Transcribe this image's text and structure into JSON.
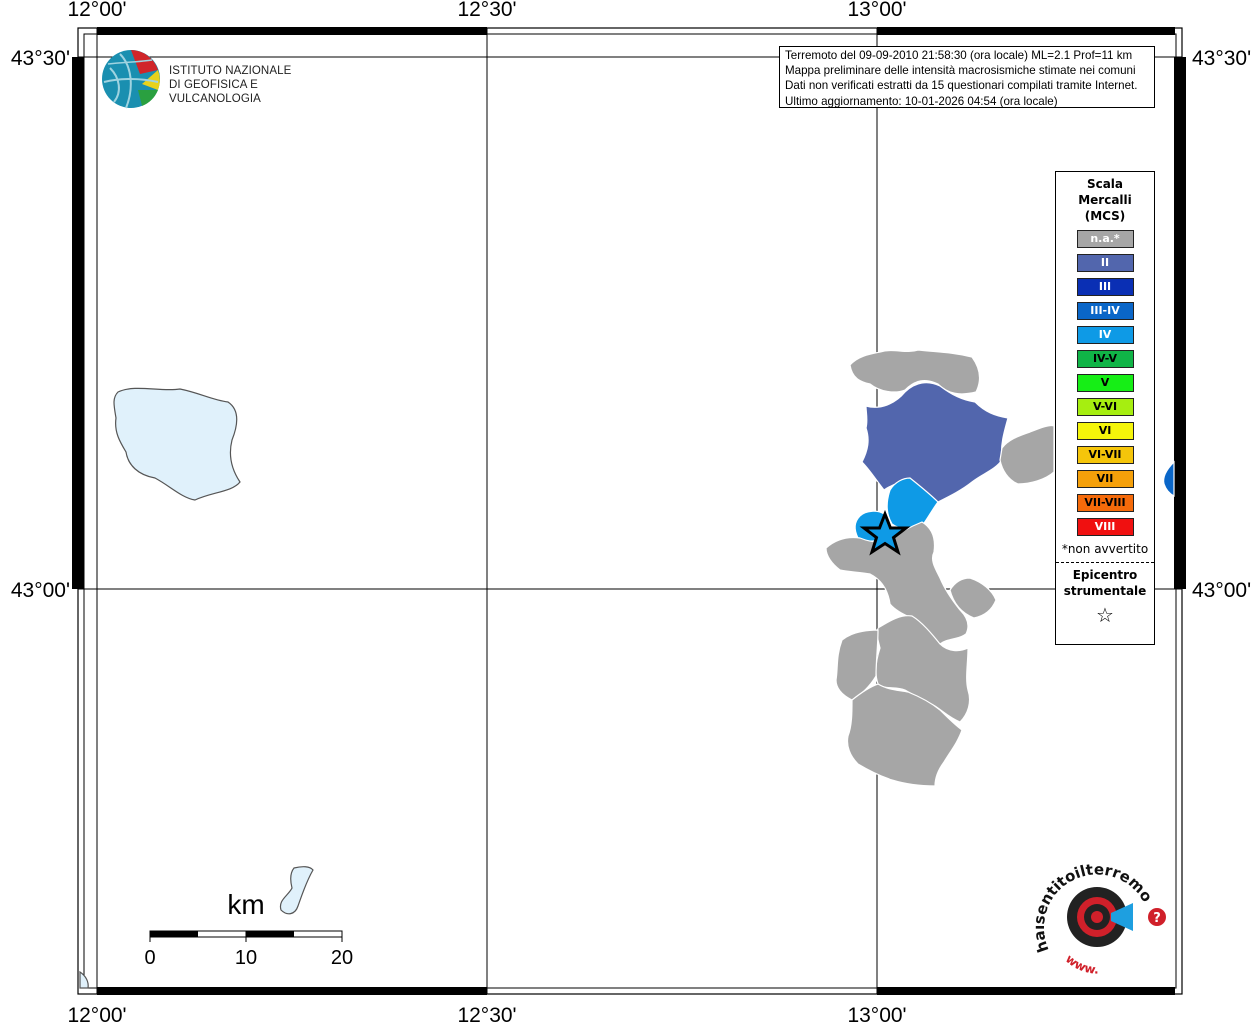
{
  "map": {
    "lon_labels": [
      "12°00'",
      "12°30'",
      "13°00'"
    ],
    "lat_labels": [
      "43°30'",
      "43°00'"
    ]
  },
  "info_box": {
    "lines": [
      "Terremoto del 09-09-2010 21:58:30 (ora locale) ML=2.1 Prof=11 km",
      "Mappa preliminare delle intensità macrosismiche stimate nei comuni",
      "Dati non verificati estratti da 15 questionari compilati tramite Internet.",
      "Ultimo aggiornamento: 10-01-2026 04:54 (ora locale)"
    ]
  },
  "logo": {
    "line1": "ISTITUTO NAZIONALE",
    "line2": "DI GEOFISICA E VULCANOLOGIA"
  },
  "legend": {
    "title_lines": [
      "Scala",
      "Mercalli",
      "(MCS)"
    ],
    "classes": [
      {
        "label": "n.a.*",
        "color": "#a6a6a6",
        "text_color": "#ffffff"
      },
      {
        "label": "II",
        "color": "#5266ad",
        "text_color": "#ffffff"
      },
      {
        "label": "III",
        "color": "#0a2fb4",
        "text_color": "#ffffff"
      },
      {
        "label": "III-IV",
        "color": "#0a66c8",
        "text_color": "#ffffff"
      },
      {
        "label": "IV",
        "color": "#0e9ae6",
        "text_color": "#ffffff"
      },
      {
        "label": "IV-V",
        "color": "#10b447",
        "text_color": "#000000"
      },
      {
        "label": "V",
        "color": "#16ee16",
        "text_color": "#000000"
      },
      {
        "label": "V-VI",
        "color": "#a6ee10",
        "text_color": "#000000"
      },
      {
        "label": "VI",
        "color": "#f5f50a",
        "text_color": "#000000"
      },
      {
        "label": "VI-VII",
        "color": "#f5c50a",
        "text_color": "#000000"
      },
      {
        "label": "VII",
        "color": "#f5a00a",
        "text_color": "#000000"
      },
      {
        "label": "VII-VIII",
        "color": "#f56a0a",
        "text_color": "#000000"
      },
      {
        "label": "VIII",
        "color": "#f01010",
        "text_color": "#ffffff"
      }
    ],
    "note": "*non avvertito",
    "epicenter_lines": [
      "Epicentro",
      "strumentale"
    ],
    "epicenter_symbol": "☆"
  },
  "scale_bar": {
    "unit": "km",
    "ticks": [
      "0",
      "10",
      "20"
    ]
  },
  "hsit_logo": {
    "text": "haisentitoilterremoto.it",
    "www": "www."
  },
  "colors": {
    "not_felt": "#a6a6a6",
    "II": "#5266ad",
    "IV": "#0e9ae6",
    "lake": "#e0f1fb"
  }
}
